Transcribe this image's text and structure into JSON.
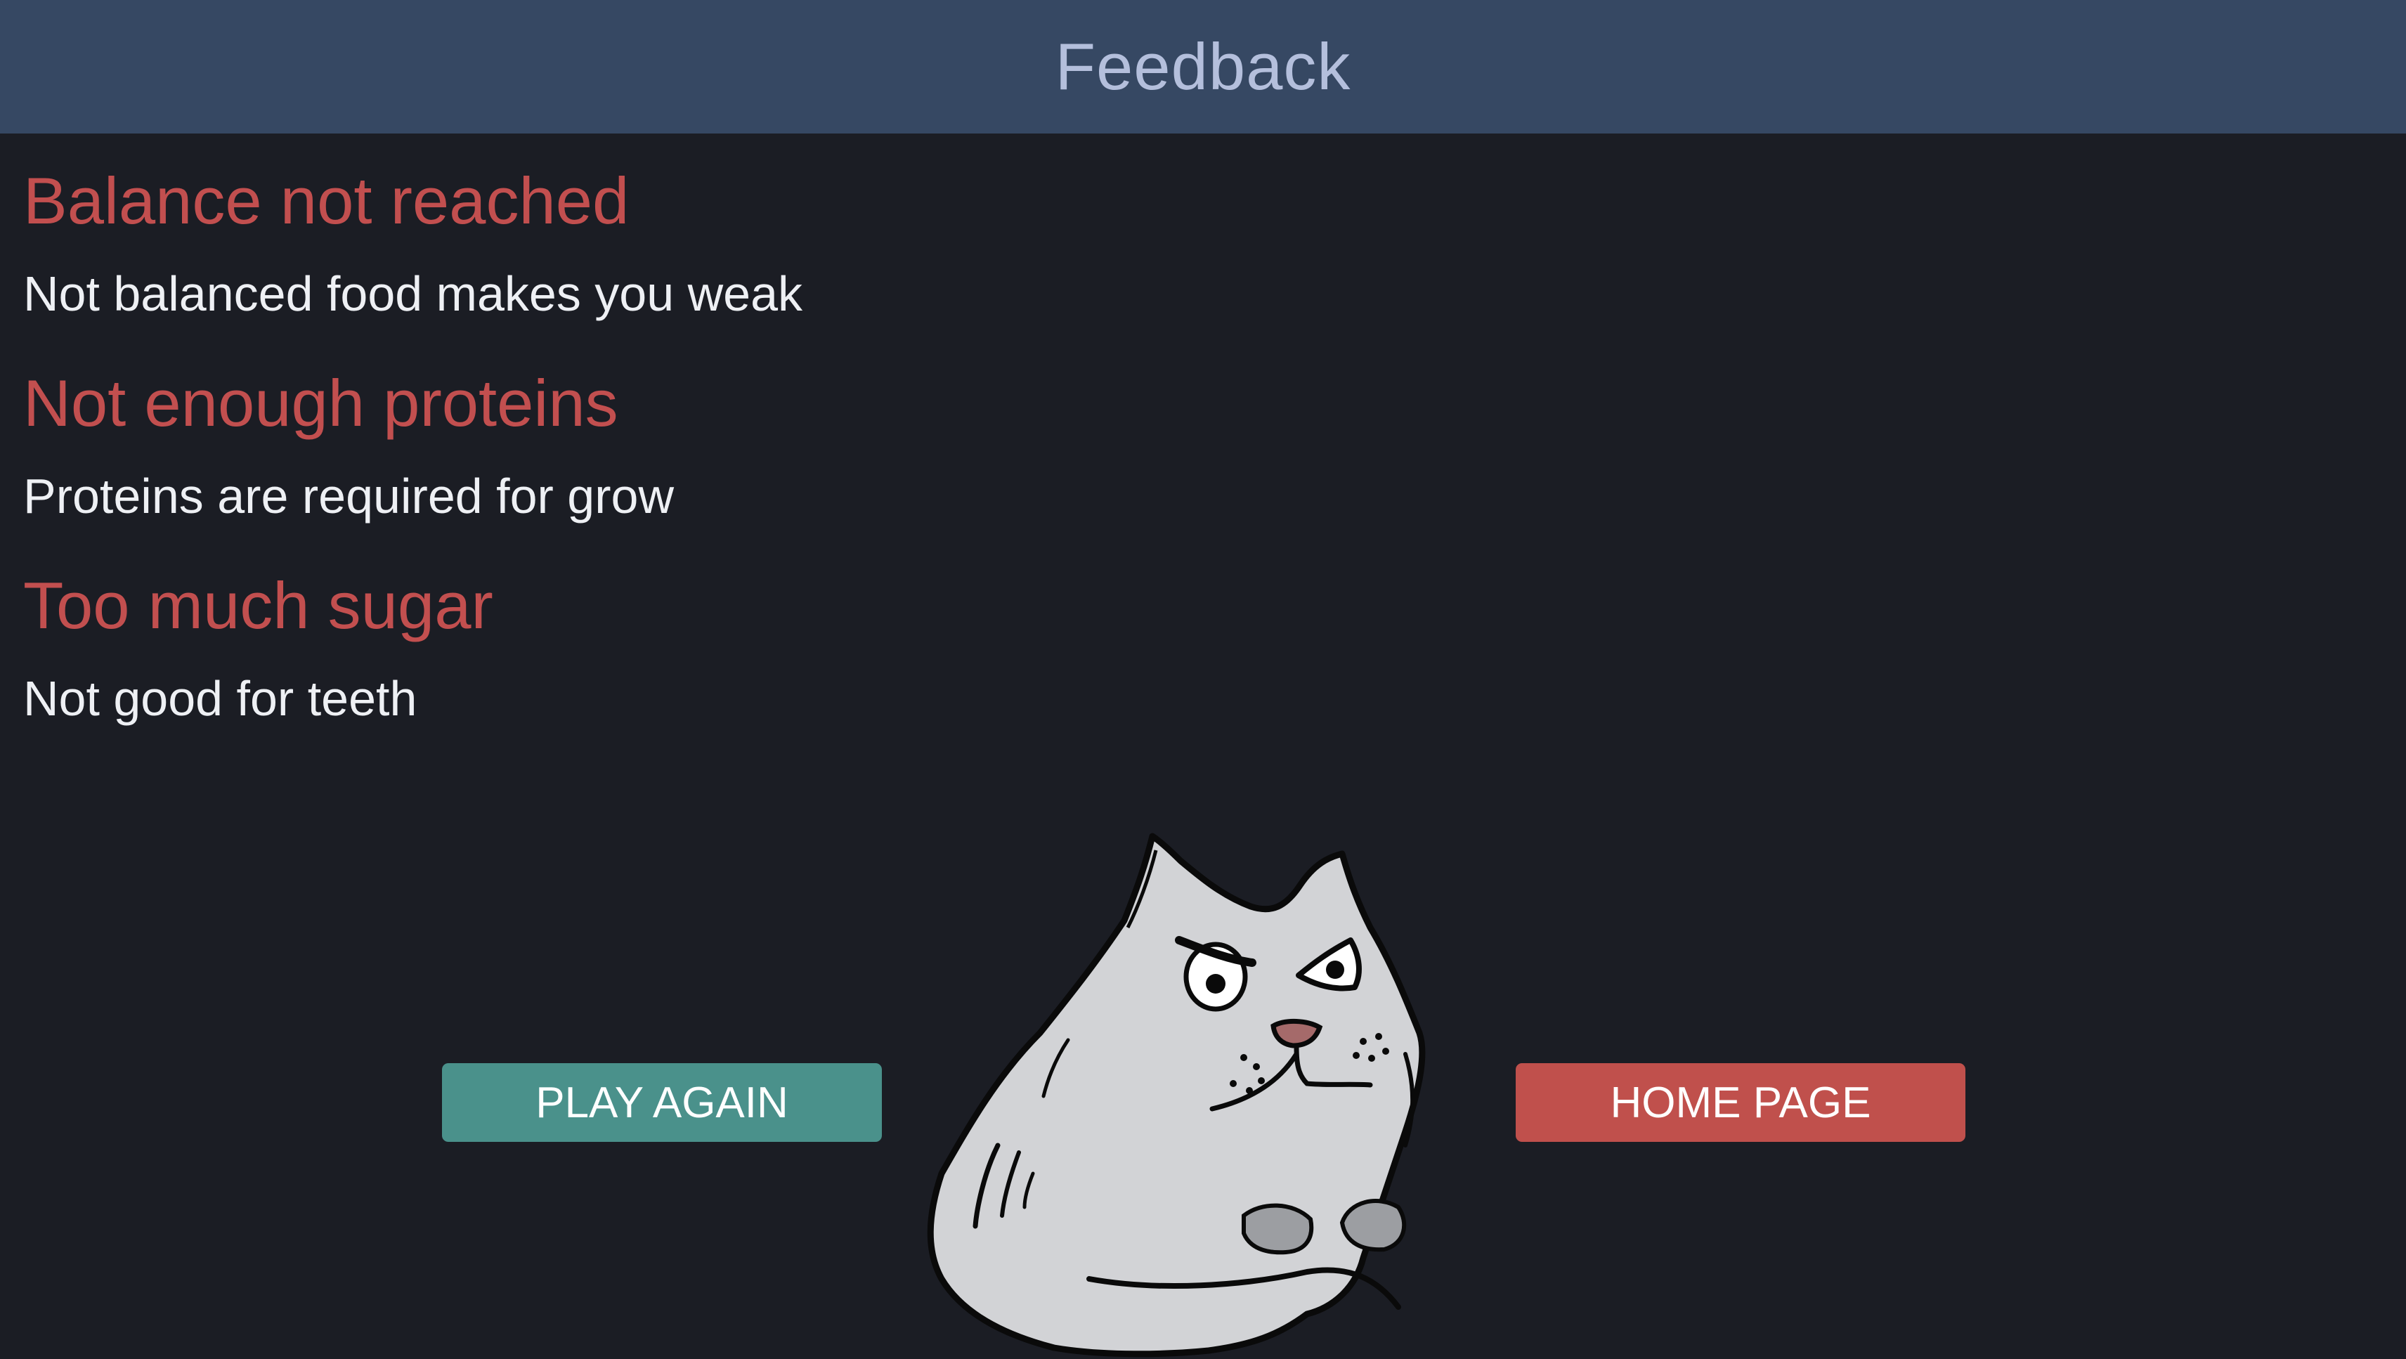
{
  "header": {
    "title": "Feedback"
  },
  "feedback": [
    {
      "title": "Balance not reached",
      "description": "Not balanced food makes you weak"
    },
    {
      "title": "Not enough proteins",
      "description": "Proteins are required for grow"
    },
    {
      "title": "Too much sugar",
      "description": "Not good for teeth"
    }
  ],
  "actions": {
    "play_again_label": "PLAY AGAIN",
    "home_page_label": "HOME PAGE"
  },
  "colors": {
    "background": "#1b1d24",
    "header": "#364863",
    "header_text": "#b4bfdc",
    "warning_title": "#c24f4f",
    "play_button": "#4a918b",
    "home_button": "#c0504c"
  },
  "illustration": {
    "icon": "grumpy-cat-illustration"
  }
}
